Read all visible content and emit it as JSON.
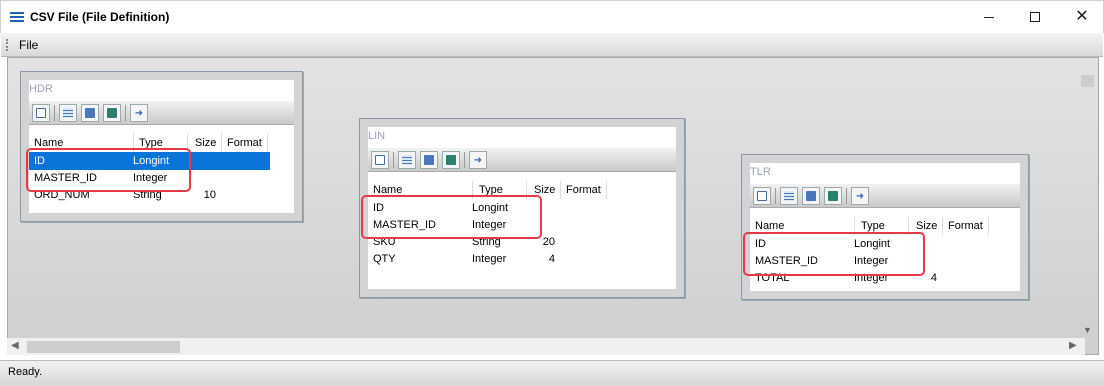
{
  "window": {
    "title": "CSV File (File Definition)"
  },
  "menu": {
    "items": [
      "File"
    ]
  },
  "columns": [
    "Name",
    "Type",
    "Size",
    "Format"
  ],
  "records": [
    {
      "name": "HDR",
      "fields": [
        {
          "name": "ID",
          "type": "Longint",
          "size": ""
        },
        {
          "name": "MASTER_ID",
          "type": "Integer",
          "size": ""
        },
        {
          "name": "ORD_NUM",
          "type": "String",
          "size": "10"
        }
      ]
    },
    {
      "name": "LIN",
      "fields": [
        {
          "name": "ID",
          "type": "Longint",
          "size": ""
        },
        {
          "name": "MASTER_ID",
          "type": "Integer",
          "size": ""
        },
        {
          "name": "SKU",
          "type": "String",
          "size": "20"
        },
        {
          "name": "QTY",
          "type": "Integer",
          "size": "4"
        }
      ]
    },
    {
      "name": "TLR",
      "fields": [
        {
          "name": "ID",
          "type": "Longint",
          "size": ""
        },
        {
          "name": "MASTER_ID",
          "type": "Integer",
          "size": ""
        },
        {
          "name": "TOTAL",
          "type": "Integer",
          "size": "4"
        }
      ]
    }
  ],
  "toolbar_icons": [
    "preview-icon",
    "grid-icon",
    "form-icon",
    "calculator-icon",
    "link-arrow-icon"
  ],
  "status": {
    "text": "Ready."
  },
  "colors": {
    "highlight": "#e53a4a",
    "selection": "#0a74d8"
  }
}
